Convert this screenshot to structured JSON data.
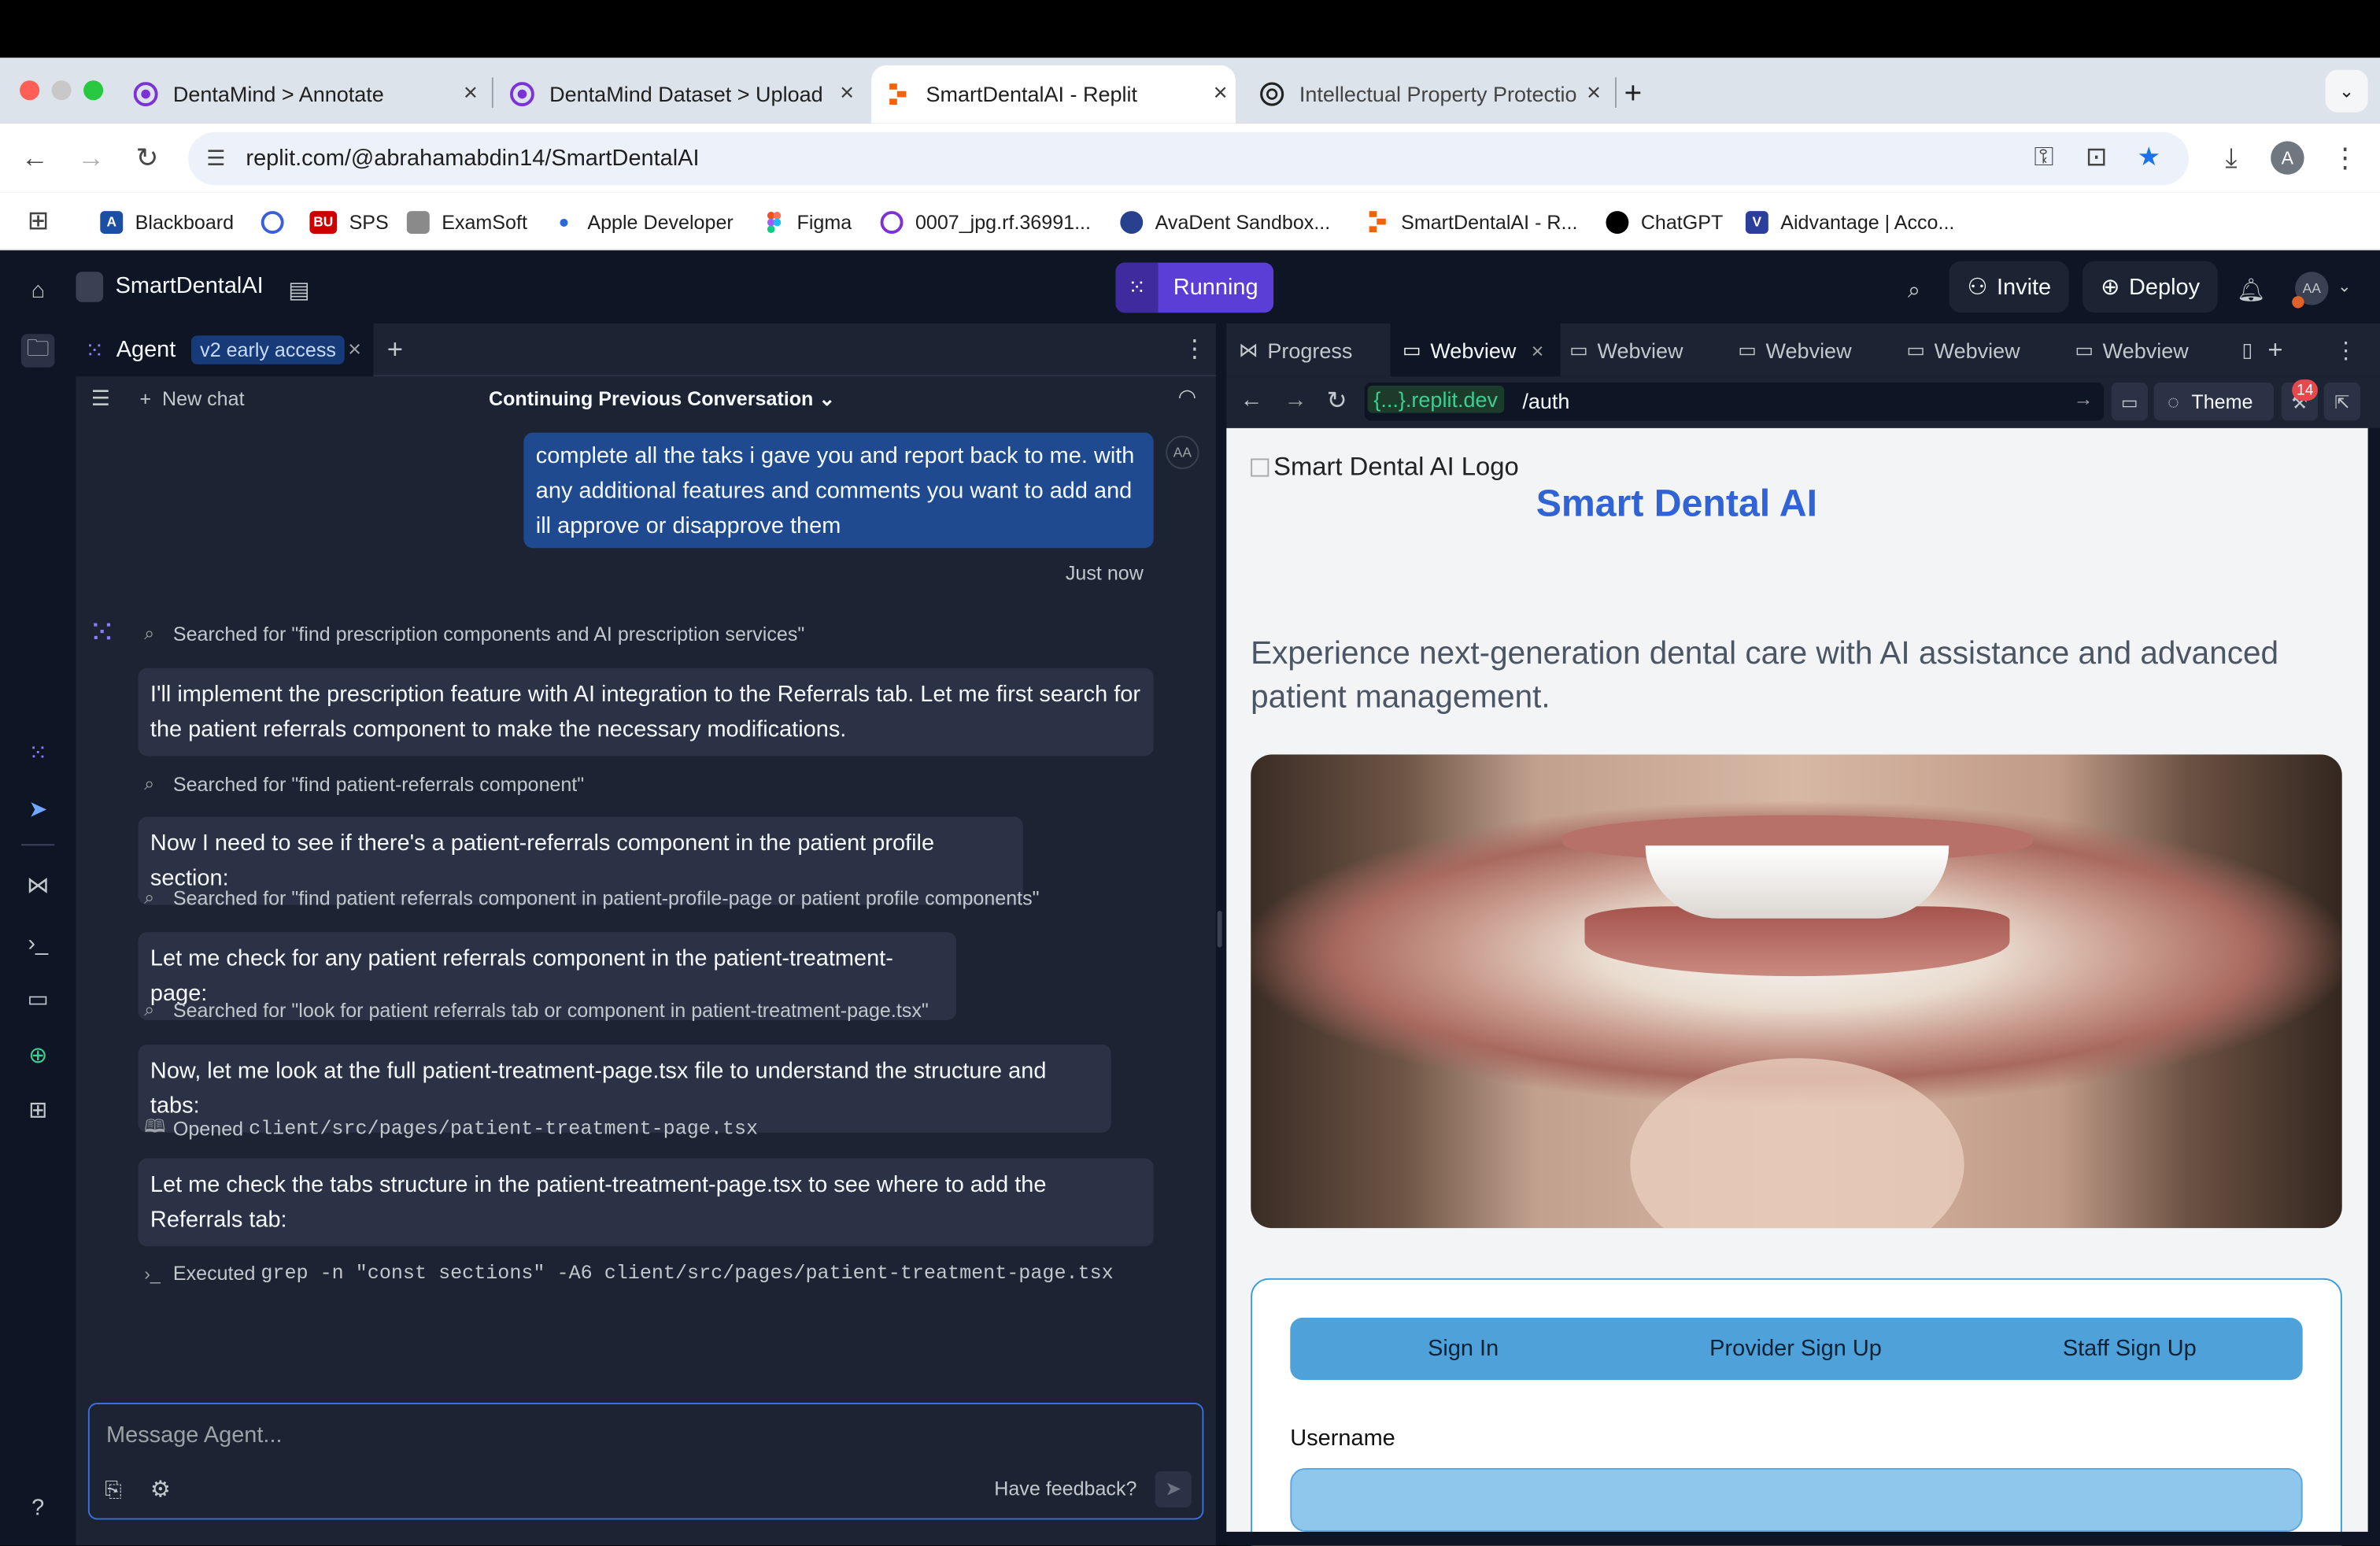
{
  "browser": {
    "tabs": [
      {
        "label": "DentaMind > Annotate"
      },
      {
        "label": "DentaMind Dataset > Upload"
      },
      {
        "label": "SmartDentalAI - Replit"
      },
      {
        "label": "Intellectual Property Protectio"
      }
    ],
    "url": "replit.com/@abrahamabdin14/SmartDentalAI",
    "profile_initial": "A",
    "bookmarks": [
      "Blackboard",
      "SPS",
      "ExamSoft",
      "Apple Developer",
      "Figma",
      "0007_jpg.rf.36991...",
      "AvaDent Sandbox...",
      "SmartDentalAI - R...",
      "ChatGPT",
      "Aidvantage | Acco..."
    ],
    "bookmark_badge": "BU"
  },
  "replit": {
    "project_name": "SmartDentalAI",
    "run_status": "Running",
    "invite_label": "Invite",
    "deploy_label": "Deploy",
    "avatar": "AA",
    "agent_tab": "Agent",
    "agent_badge": "v2 early access",
    "new_chat": "New chat",
    "conversation_title": "Continuing Previous Conversation",
    "user_avatar": "AA",
    "user_message": "complete all the taks i gave you and report back to me. with any additional features and comments you want to add and ill approve or disapprove them",
    "timestamp": "Just now",
    "chat": {
      "tool1": "Searched for \"find prescription components and AI prescription services\"",
      "msg1": "I'll implement the prescription feature with AI integration to the Referrals tab. Let me first search for the patient referrals component to make the necessary modifications.",
      "tool2": "Searched for \"find patient-referrals component\"",
      "msg2": "Now I need to see if there's a patient-referrals component in the patient profile section:",
      "tool3": "Searched for \"find patient referrals component in patient-profile-page or patient profile components\"",
      "msg3": "Let me check for any patient referrals component in the patient-treatment-page:",
      "tool4": "Searched for \"look for patient referrals tab or component in patient-treatment-page.tsx\"",
      "msg4": "Now, let me look at the full patient-treatment-page.tsx file to understand the structure and tabs:",
      "tool5_prefix": "Opened",
      "tool5_path": "client/src/pages/patient-treatment-page.tsx",
      "msg5": "Let me check the tabs structure in the patient-treatment-page.tsx to see where to add the Referrals tab:",
      "tool6_prefix": "Executed",
      "tool6_cmd": "grep -n \"const sections\" -A6 client/src/pages/patient-treatment-page.tsx"
    },
    "composer_placeholder": "Message Agent...",
    "feedback": "Have feedback?",
    "right_tabs": [
      "Progress",
      "Webview",
      "Webview",
      "Webview",
      "Webview",
      "Webview"
    ],
    "webview_domain": "{...}.replit.dev",
    "webview_path": "/auth",
    "theme_label": "Theme",
    "notif_count": "14"
  },
  "site": {
    "logo_alt": "Smart Dental AI Logo",
    "title": "Smart Dental AI",
    "tagline": "Experience next-generation dental care with AI assistance and advanced patient management.",
    "auth_tabs": [
      "Sign In",
      "Provider Sign Up",
      "Staff Sign Up"
    ],
    "username_label": "Username"
  },
  "colors": {
    "replit_bg": "#0e1525",
    "replit_panel": "#1c2333",
    "accent_purple": "#5b3ed6",
    "site_title_blue": "#2f63d6",
    "auth_tab_blue": "#4ea1d9"
  }
}
